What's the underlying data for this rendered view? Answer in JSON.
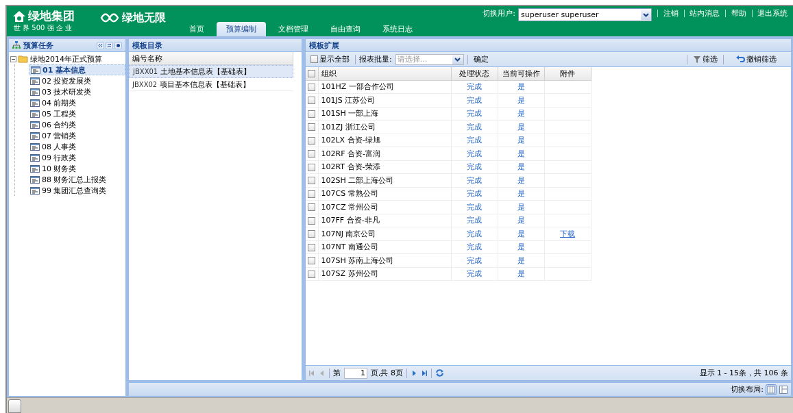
{
  "header": {
    "logo": {
      "name": "绿地集团",
      "tagline": "世 界 500 强 企 业"
    },
    "logo2": {
      "name": "绿地无限"
    },
    "nav": [
      {
        "label": "首页",
        "selected": false
      },
      {
        "label": "预算编制",
        "selected": true
      },
      {
        "label": "文档管理",
        "selected": false
      },
      {
        "label": "自由查询",
        "selected": false
      },
      {
        "label": "系统日志",
        "selected": false
      }
    ],
    "user_switch": {
      "label": "切换用户:",
      "value": "superuser superuser"
    },
    "links": [
      "注销",
      "站内消息",
      "帮助",
      "退出系统"
    ]
  },
  "tree_panel": {
    "title": "预算任务",
    "root": {
      "label": "绿地2014年正式预算",
      "expanded": true,
      "children": [
        {
          "label": "01 基本信息",
          "selected": true
        },
        {
          "label": "02 投资发展类",
          "selected": false
        },
        {
          "label": "03 技术研发类",
          "selected": false
        },
        {
          "label": "04 前期类",
          "selected": false
        },
        {
          "label": "05 工程类",
          "selected": false
        },
        {
          "label": "06 合约类",
          "selected": false
        },
        {
          "label": "07 营销类",
          "selected": false
        },
        {
          "label": "08 人事类",
          "selected": false
        },
        {
          "label": "09 行政类",
          "selected": false
        },
        {
          "label": "10 财务类",
          "selected": false
        },
        {
          "label": "88 财务汇总上报类",
          "selected": false
        },
        {
          "label": "99 集团汇总查询类",
          "selected": false
        }
      ]
    }
  },
  "template_panel": {
    "title": "模板目录",
    "column": "编号名称",
    "rows": [
      {
        "code": "JBXX01",
        "name": "土地基本信息表【基础表】",
        "selected": true
      },
      {
        "code": "JBXX02",
        "name": "项目基本信息表【基础表】",
        "selected": false
      }
    ]
  },
  "grid_panel": {
    "title": "模板扩展",
    "show_all": {
      "label": "显示全部",
      "checked": false
    },
    "batch": {
      "label": "报表批量:",
      "placeholder": "请选择..."
    },
    "confirm": "确定",
    "filter": "筛选",
    "unfilter": "撤销筛选",
    "select_all": {
      "checked": false
    },
    "columns": [
      "组织",
      "处理状态",
      "当前可操作",
      "附件"
    ],
    "rows": [
      {
        "org": "101HZ 一部合作公司",
        "status": "完成",
        "operable": "是",
        "checked": false
      },
      {
        "org": "101JS 江苏公司",
        "status": "完成",
        "operable": "是",
        "checked": false
      },
      {
        "org": "101SH 一部上海",
        "status": "完成",
        "operable": "是",
        "checked": false
      },
      {
        "org": "101ZJ 浙江公司",
        "status": "完成",
        "operable": "是",
        "checked": false
      },
      {
        "org": "102LX 合资-绿旭",
        "status": "完成",
        "operable": "是",
        "checked": false
      },
      {
        "org": "102RF 合资-富润",
        "status": "完成",
        "operable": "是",
        "checked": false
      },
      {
        "org": "102RT 合资-荣添",
        "status": "完成",
        "operable": "是",
        "checked": false
      },
      {
        "org": "102SH 二部上海公司",
        "status": "完成",
        "operable": "是",
        "checked": false
      },
      {
        "org": "107CS 常熟公司",
        "status": "完成",
        "operable": "是",
        "checked": false
      },
      {
        "org": "107CZ 常州公司",
        "status": "完成",
        "operable": "是",
        "checked": false
      },
      {
        "org": "107FF 合资-非凡",
        "status": "完成",
        "operable": "是",
        "checked": false
      },
      {
        "org": "107NJ 南京公司",
        "status": "完成",
        "operable": "是",
        "attachment": "下载",
        "checked": false
      },
      {
        "org": "107NT 南通公司",
        "status": "完成",
        "operable": "是",
        "checked": false
      },
      {
        "org": "107SH 苏南上海公司",
        "status": "完成",
        "operable": "是",
        "checked": false
      },
      {
        "org": "107SZ 苏州公司",
        "status": "完成",
        "operable": "是",
        "checked": false
      }
    ],
    "pager": {
      "page_prefix": "第",
      "page": "1",
      "page_suffix": "页,共 8页",
      "summary": "显示 1 - 15条，共 106 条"
    }
  },
  "layout_switch": {
    "label": "切换布局:"
  }
}
